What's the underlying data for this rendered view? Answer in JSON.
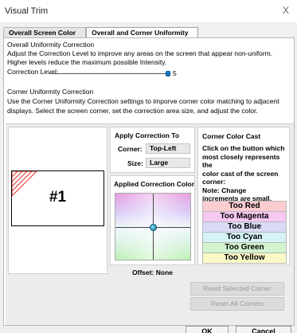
{
  "window": {
    "title": "Visual Trim",
    "close_glyph": "X"
  },
  "tabs": [
    {
      "label": "Overall Screen Color",
      "active": false
    },
    {
      "label": "Overall and Corner Uniformity",
      "active": true
    }
  ],
  "uniformity": {
    "heading": "Overall Uniformity Correction",
    "desc_1": "Adjust the Correction Level to improve any areas on the screen that appear non-uniform.",
    "desc_2": "Higher levels reduce the maximum possible Intensity.",
    "level_label": "Correction Level:",
    "level_value": "5",
    "level_fraction": 1.0
  },
  "corner_uniformity": {
    "heading": "Corner Uniformity Correction",
    "desc_1": "Use the Corner Uniformity Correction settings to imporve corner color matching to adjacent",
    "desc_2": "displays. Select the screen corner, set the correction area size, and adjust the color."
  },
  "screen": {
    "label": "#1",
    "selected_corner": "top-left"
  },
  "apply": {
    "heading": "Apply Correction To",
    "corner_label": "Corner:",
    "corner_value": "Top-Left",
    "size_label": "Size:",
    "size_value": "Large"
  },
  "applied_color": {
    "heading": "Applied Correction Color",
    "offset_text": "Offset: None",
    "marker_x": 0.5,
    "marker_y": 0.5
  },
  "cast": {
    "heading": "Corner Color Cast",
    "desc_lines": [
      "Click on the button which",
      "most closely represents the",
      "color cast of the screen",
      "corner:",
      "Note: Change",
      "increments are small."
    ],
    "buttons": [
      {
        "label": "Too Red",
        "color": "#fccdd0"
      },
      {
        "label": "Too Magenta",
        "color": "#f7c8f2"
      },
      {
        "label": "Too Blue",
        "color": "#d9daf6"
      },
      {
        "label": "Too Cyan",
        "color": "#d5f2f6"
      },
      {
        "label": "Too Green",
        "color": "#d2f5d0"
      },
      {
        "label": "Too Yellow",
        "color": "#fbf8c8"
      }
    ]
  },
  "actions": {
    "reset_selected": "Reset Selected Corner",
    "reset_all": "Reset All Corners",
    "ok": "OK",
    "cancel": "Cancel"
  },
  "colors": {
    "accent": "#1b7ac4",
    "hatch": "#e0302a"
  }
}
